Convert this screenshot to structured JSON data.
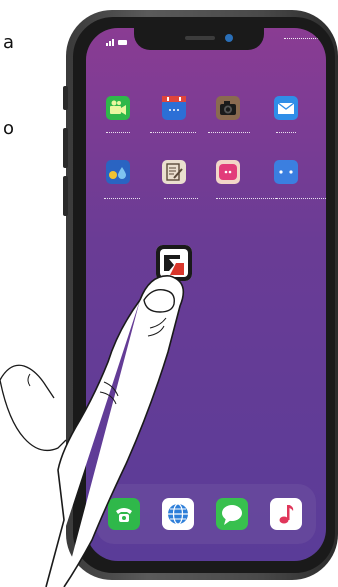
{
  "side_text": {
    "first": "a",
    "second": "o"
  },
  "status_bar": {
    "signal": "░▮ ▬"
  },
  "home_row1": [
    {
      "name": "video-camera-app",
      "icon": "video-camera-icon",
      "color": "#2fb84a"
    },
    {
      "name": "calendar-app",
      "icon": "calendar-icon",
      "color": "#2c6fd6"
    },
    {
      "name": "camera-app",
      "icon": "camera-icon",
      "color": "#8a6a50"
    },
    {
      "name": "mail-app",
      "icon": "mail-icon",
      "color": "#2f8ee8"
    }
  ],
  "home_row2": [
    {
      "name": "weather-app",
      "icon": "water-drops-icon",
      "color": "#2a64c2"
    },
    {
      "name": "notes-app",
      "icon": "notepad-pencil-icon",
      "color": "#eadfcf"
    },
    {
      "name": "chat-bubble-app",
      "icon": "face-dots-icon",
      "color": "#f2d6c8"
    },
    {
      "name": "games-app",
      "icon": "face-dots-icon",
      "color": "#3b7fe0"
    }
  ],
  "dragged_app": {
    "icon": "app-switch-icon"
  },
  "dock": [
    {
      "name": "phone-app",
      "icon": "telephone-icon",
      "color": "#2fb84a"
    },
    {
      "name": "browser-app",
      "icon": "globe-icon",
      "color": "#ffffff"
    },
    {
      "name": "messages-app",
      "icon": "speech-bubble-icon",
      "color": "#38c04e"
    },
    {
      "name": "music-app",
      "icon": "music-note-icon",
      "color": "#ffffff"
    }
  ]
}
